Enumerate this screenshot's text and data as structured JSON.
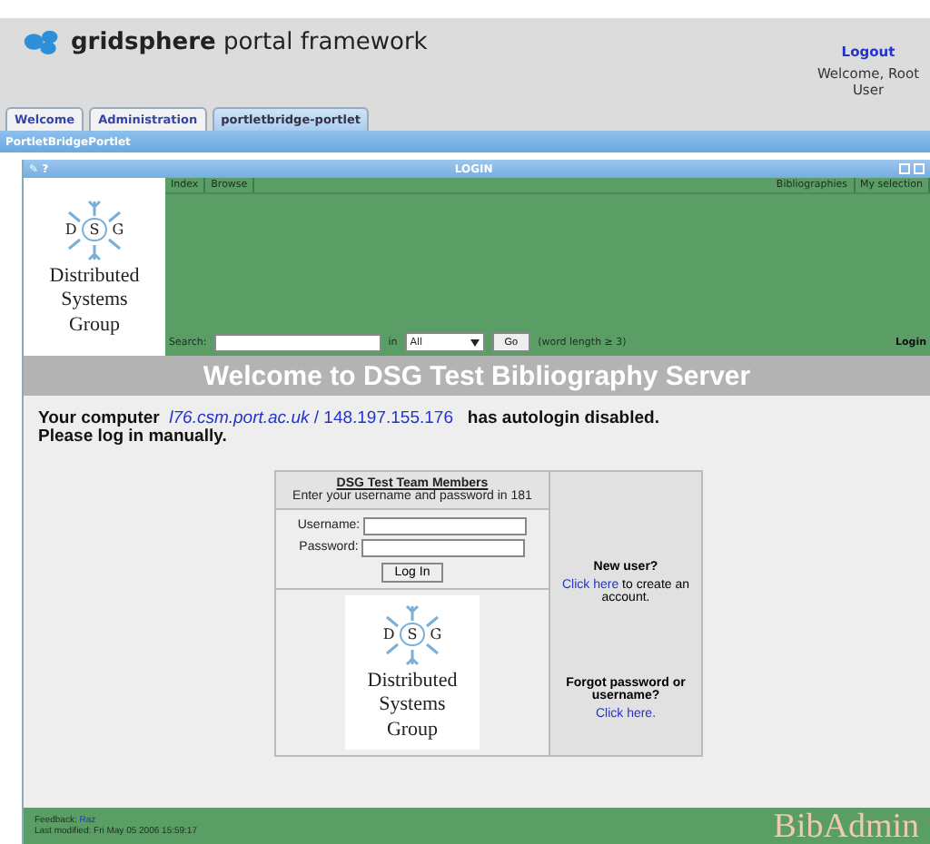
{
  "header": {
    "brand_bold": "gridsphere",
    "brand_rest": "portal framework",
    "logout": "Logout",
    "welcome": "Welcome, Root User"
  },
  "tabs": [
    {
      "label": "Welcome",
      "selected": false
    },
    {
      "label": "Administration",
      "selected": false
    },
    {
      "label": "portletbridge-portlet",
      "selected": true
    }
  ],
  "subtabs": [
    {
      "label": "PortletBridgePortlet",
      "selected": true
    }
  ],
  "portlet": {
    "tools": "✎ ?",
    "title": "LOGIN"
  },
  "logos": [
    {
      "letters": [
        "D",
        "S",
        "G"
      ],
      "lines": [
        "Distributed",
        "Systems",
        "Group"
      ]
    },
    {
      "letters": [
        "D",
        "S",
        "G"
      ],
      "lines": [
        "Distributed",
        "Systems",
        "Group"
      ]
    }
  ],
  "nav": {
    "left": [
      "Index",
      "Browse"
    ],
    "right": [
      "Bibliographies",
      "My selection"
    ]
  },
  "search": {
    "label": "Search:",
    "in": "in",
    "scope": "All",
    "go": "Go",
    "hint": "(word length ≥ 3)",
    "login": "Login"
  },
  "banner": "Welcome to DSG Test Bibliography Server",
  "notice": {
    "before": "Your computer",
    "host": "l76.csm.port.ac.uk",
    "sep": "/",
    "ip": "148.197.155.176",
    "after": "has autologin disabled.",
    "line2": "Please log in manually."
  },
  "login_box": {
    "title": "DSG Test Team Members",
    "subtitle": "Enter your username and password in 181",
    "username_label": "Username:",
    "password_label": "Password:",
    "button": "Log In"
  },
  "side": {
    "new_user": "New user?",
    "click_here": "Click here",
    "to_create": "to create an account.",
    "forgot": "Forgot password or username?",
    "forgot_link": "Click here."
  },
  "footer": {
    "feedback_label": "Feedback:",
    "feedback_link": "Raz",
    "modified": "Last modified: Fri May 05 2006 15:59:17",
    "logo": "BibAdmin"
  }
}
